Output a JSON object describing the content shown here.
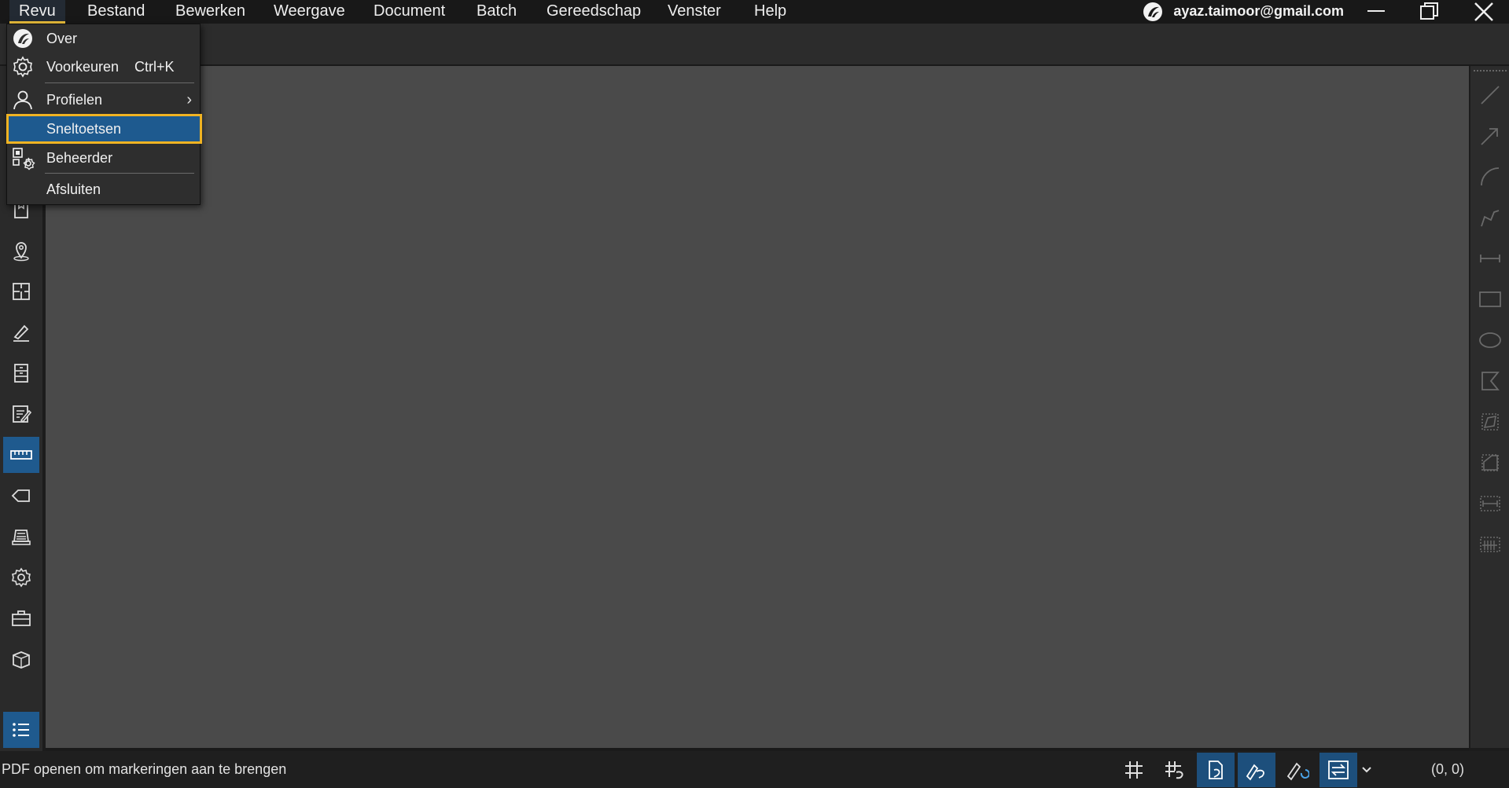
{
  "menubar": {
    "items": [
      "Revu",
      "Bestand",
      "Bewerken",
      "Weergave",
      "Document",
      "Batch",
      "Gereedschap",
      "Venster",
      "Help"
    ],
    "account": "ayaz.taimoor@gmail.com"
  },
  "revu_menu": {
    "items": [
      {
        "label": "Over",
        "icon": "bluebeam-logo-icon"
      },
      {
        "label": "Voorkeuren",
        "shortcut": "Ctrl+K",
        "icon": "gear-icon"
      },
      {
        "label": "Profielen",
        "icon": "user-icon",
        "has_submenu": true
      },
      {
        "label": "Sneltoetsen",
        "highlighted": true
      },
      {
        "label": "Beheerder",
        "icon": "admin-icon"
      },
      {
        "label": "Afsluiten"
      }
    ],
    "submenu_arrow": "›"
  },
  "status": {
    "text": "PDF openen om markeringen aan te brengen",
    "coords": "(0, 0)"
  },
  "colors": {
    "accent_blue": "#1e5a8f",
    "highlight_outline": "#f0b323",
    "canvas": "#4a4a4a"
  }
}
